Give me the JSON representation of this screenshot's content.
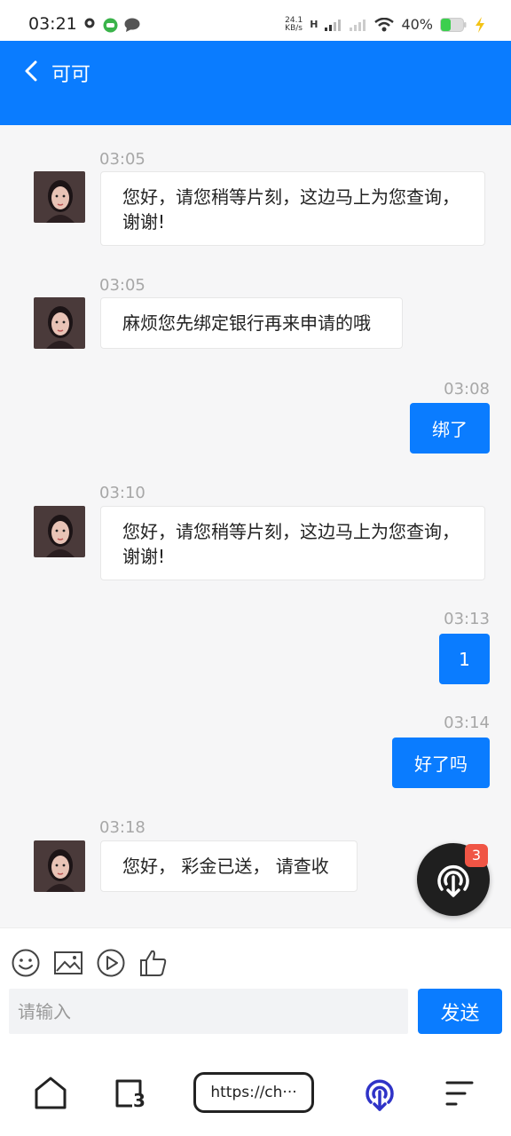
{
  "status_bar": {
    "time": "03:21",
    "net_speed": "24.1",
    "net_unit": "KB/s",
    "net_type": "H",
    "battery": "40%"
  },
  "header": {
    "title": "可可"
  },
  "messages": [
    {
      "side": "left",
      "time": "03:05",
      "text": "您好，请您稍等片刻，这边马上为您查询，谢谢!"
    },
    {
      "side": "left",
      "time": "03:05",
      "text": "麻烦您先绑定银行再来申请的哦"
    },
    {
      "side": "right",
      "time": "03:08",
      "text": "绑了"
    },
    {
      "side": "left",
      "time": "03:10",
      "text": "您好，请您稍等片刻，这边马上为您查询，谢谢!"
    },
    {
      "side": "right",
      "time": "03:13",
      "text": "1"
    },
    {
      "side": "right",
      "time": "03:14",
      "text": "好了吗"
    },
    {
      "side": "left",
      "time": "03:18",
      "text": "您好， 彩金已送， 请查收"
    }
  ],
  "float_badge": "3",
  "composer": {
    "placeholder": "请输入",
    "send_label": "发送"
  },
  "browser_nav": {
    "url": "https://ch···",
    "tab_count": "3"
  },
  "colors": {
    "accent": "#0a7cff",
    "badge": "#f05545"
  }
}
